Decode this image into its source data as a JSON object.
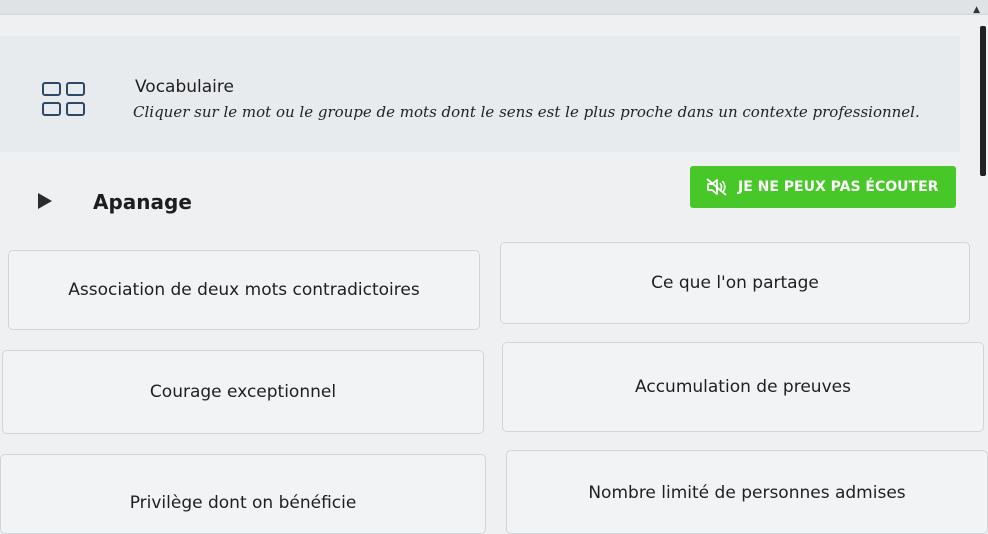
{
  "header": {
    "title": "Vocabulaire",
    "instruction": "Cliquer sur le mot ou le groupe de mots dont le sens est le plus proche dans un contexte professionnel."
  },
  "question": {
    "word": "Apanage",
    "listen_button_label": "JE NE PEUX PAS ÉCOUTER"
  },
  "answers": [
    {
      "label": "Association de deux mots contradictoires"
    },
    {
      "label": "Ce que l'on partage"
    },
    {
      "label": "Courage exceptionnel"
    },
    {
      "label": "Accumulation de preuves"
    },
    {
      "label": "Privilège dont on bénéficie"
    },
    {
      "label": "Nombre limité de personnes admises"
    }
  ],
  "colors": {
    "accent_green": "#48c729",
    "icon_blue": "#2c4a67"
  },
  "icons": [
    "cards-icon",
    "play-icon",
    "speaker-muted-icon",
    "scroll-up-icon"
  ]
}
